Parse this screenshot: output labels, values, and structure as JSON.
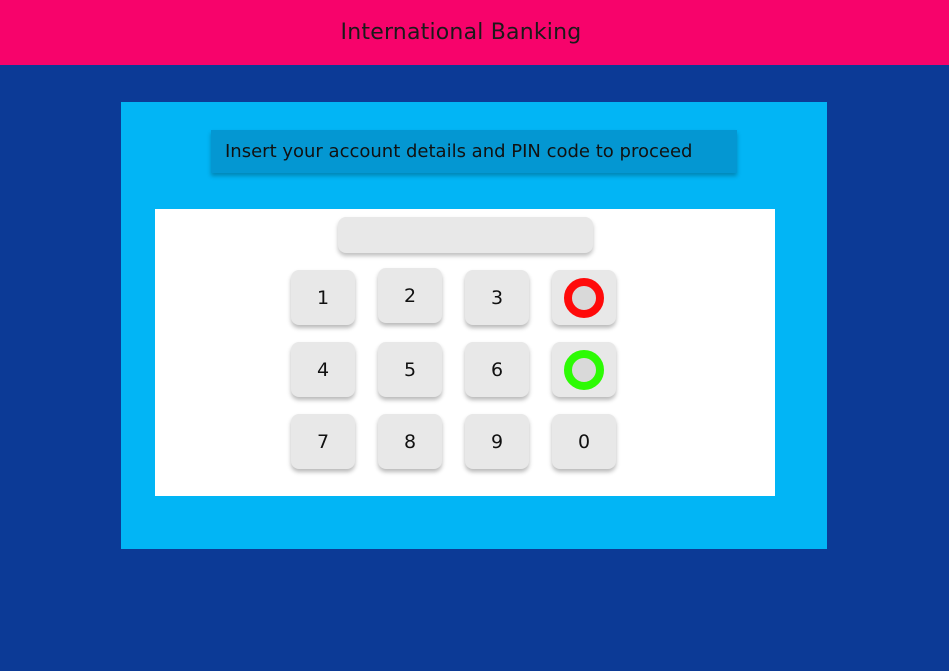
{
  "header": {
    "title": "International Banking"
  },
  "panel": {
    "instructions": "Insert your account details and PIN code to proceed"
  },
  "pin_display": {
    "value": "",
    "placeholder": ""
  },
  "keypad": {
    "keys": [
      "1",
      "2",
      "3",
      "4",
      "5",
      "6",
      "7",
      "8",
      "9",
      "0"
    ],
    "cancel_icon": "red-ring-icon",
    "confirm_icon": "green-ring-icon"
  },
  "colors": {
    "background": "#0c3a96",
    "header": "#f7036b",
    "panel": "#02b5f5",
    "instructions_bar": "#0497d2",
    "key": "#e8e8e8",
    "cancel": "#ff0a0a",
    "confirm": "#2dfb05"
  }
}
